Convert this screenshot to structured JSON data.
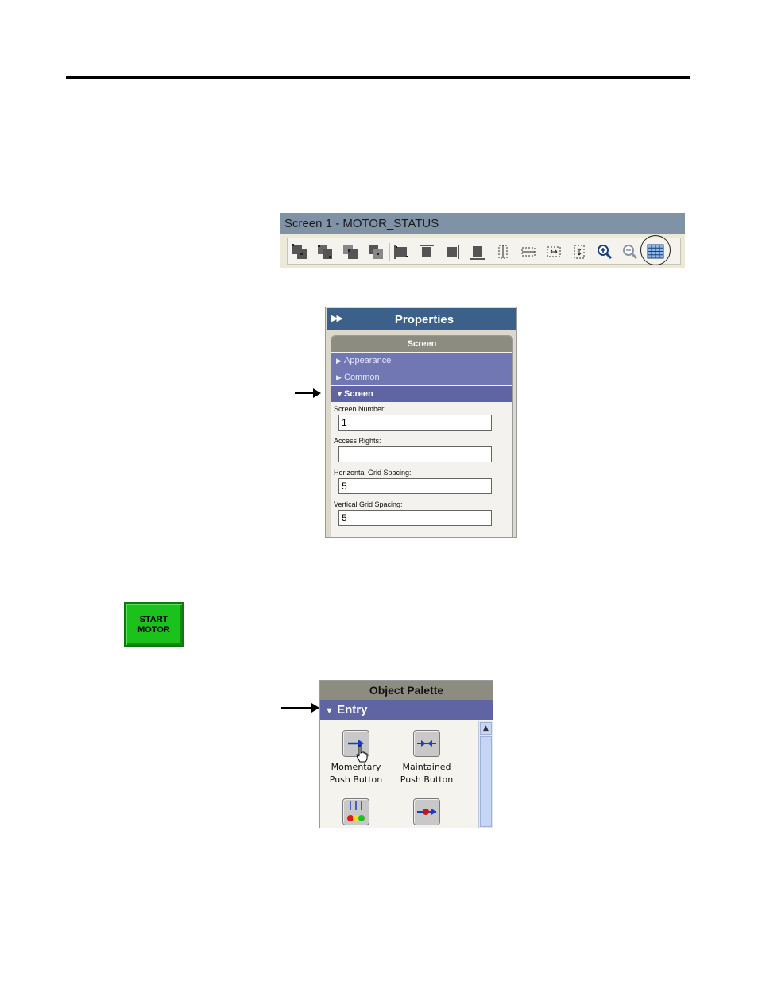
{
  "toolbar": {
    "title": "Screen 1 - MOTOR_STATUS",
    "buttons": [
      {
        "icon": "bring-to-front-icon"
      },
      {
        "icon": "send-to-back-icon"
      },
      {
        "icon": "bring-forward-icon"
      },
      {
        "icon": "send-backward-icon"
      },
      {
        "icon": "align-left-icon"
      },
      {
        "icon": "align-top-icon"
      },
      {
        "icon": "align-right-icon"
      },
      {
        "icon": "align-bottom-icon"
      },
      {
        "icon": "center-vertically-icon"
      },
      {
        "icon": "center-horizontally-icon"
      },
      {
        "icon": "space-horizontally-icon"
      },
      {
        "icon": "space-vertically-icon"
      },
      {
        "icon": "zoom-in-icon"
      },
      {
        "icon": "zoom-out-icon"
      },
      {
        "icon": "grid-icon"
      }
    ]
  },
  "properties": {
    "title": "Properties",
    "subheader": "Screen",
    "sections": {
      "appearance": "Appearance",
      "common": "Common",
      "screen": "Screen"
    },
    "fields": {
      "screen_number_label": "Screen Number:",
      "screen_number_value": "1",
      "access_rights_label": "Access Rights:",
      "access_rights_value": "",
      "h_grid_label": "Horizontal Grid Spacing:",
      "h_grid_value": "5",
      "v_grid_label": "Vertical Grid Spacing:",
      "v_grid_value": "5"
    }
  },
  "start_button": {
    "line1": "START",
    "line2": "MOTOR"
  },
  "palette": {
    "title": "Object Palette",
    "section": "Entry",
    "items": [
      {
        "line1": "Momentary",
        "line2": "Push Button",
        "icon": "momentary-push-button-icon"
      },
      {
        "line1": "Maintained",
        "line2": "Push Button",
        "icon": "maintained-push-button-icon"
      },
      {
        "icon": "multistate-push-button-icon"
      },
      {
        "icon": "interlocked-push-button-icon"
      }
    ]
  },
  "colors": {
    "toolbar_title_bg": "#8093a6",
    "properties_header_bg": "#3b6089",
    "section_bg": "#5f64a3",
    "start_button_bg": "#1cc21c"
  }
}
